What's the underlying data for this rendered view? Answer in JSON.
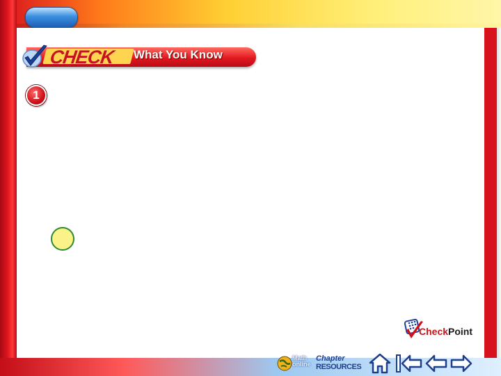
{
  "banner": {
    "check_word": "CHECK",
    "title": "What You Know"
  },
  "question": {
    "number": "1"
  },
  "checkpoint": {
    "check_word": "Check",
    "point_word": "Point"
  },
  "nav": {
    "math_online_line1": "Math",
    "math_online_line2": "online",
    "chapter_word": "Chapter",
    "resources_word": "RESOURCES",
    "home_icon": "home-icon",
    "first_icon": "first-slide-icon",
    "back_icon": "previous-arrow-icon",
    "forward_icon": "next-arrow-icon"
  },
  "colors": {
    "frame_red": "#d8121c",
    "banner_yellow": "#ffd451",
    "answer_dot_fill": "#fbf28a",
    "answer_dot_border": "#2f8a2f",
    "nav_blue": "#1d3f8a"
  }
}
